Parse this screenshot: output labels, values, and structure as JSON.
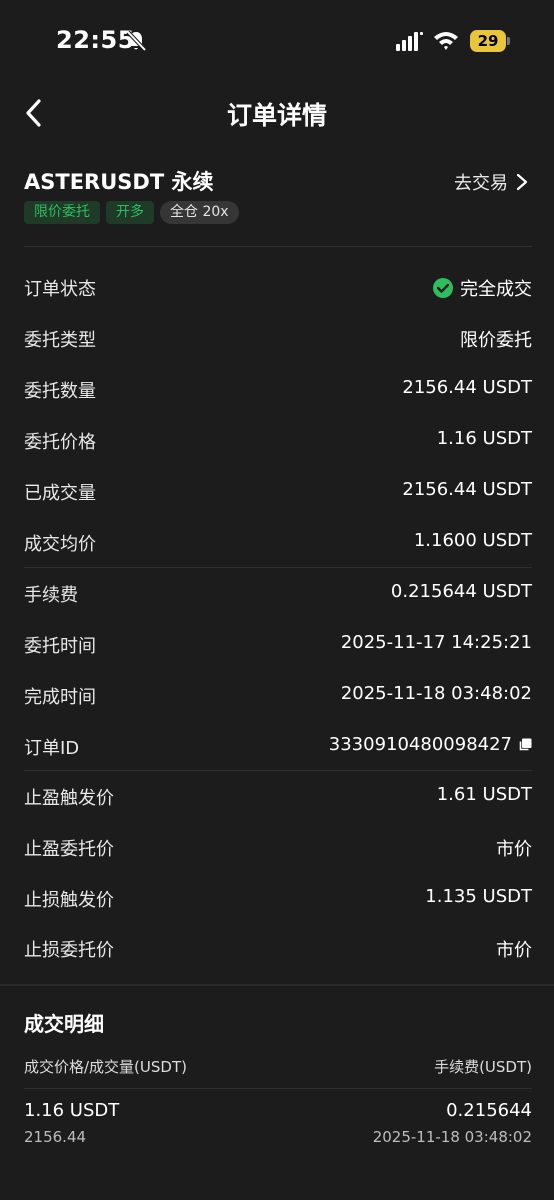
{
  "status_bar": {
    "time": "22:55",
    "battery": "29"
  },
  "header": {
    "title": "订单详情"
  },
  "order": {
    "symbol": "ASTERUSDT 永续",
    "trade_link": "去交易",
    "tags": [
      "限价委托",
      "开多",
      "全仓 20x"
    ]
  },
  "fields": [
    {
      "label": "订单状态",
      "value": "完全成交"
    },
    {
      "label": "委托类型",
      "value": "限价委托"
    },
    {
      "label": "委托数量",
      "value": "2156.44 USDT"
    },
    {
      "label": "委托价格",
      "value": "1.16 USDT"
    },
    {
      "label": "已成交量",
      "value": "2156.44 USDT"
    },
    {
      "label": "成交均价",
      "value": "1.1600 USDT"
    },
    {
      "label": "手续费",
      "value": "0.215644 USDT"
    },
    {
      "label": "委托时间",
      "value": "2025-11-17 14:25:21"
    },
    {
      "label": "完成时间",
      "value": "2025-11-18 03:48:02"
    },
    {
      "label": "订单ID",
      "value": "3330910480098427"
    },
    {
      "label": "止盈触发价",
      "value": "1.61 USDT"
    },
    {
      "label": "止盈委托价",
      "value": "市价"
    },
    {
      "label": "止损触发价",
      "value": "1.135 USDT"
    },
    {
      "label": "止损委托价",
      "value": "市价"
    }
  ],
  "fills": {
    "title": "成交明细",
    "col_left": "成交价格/成交量(USDT)",
    "col_right": "手续费(USDT)",
    "rows": [
      {
        "price": "1.16 USDT",
        "qty": "2156.44",
        "fee": "0.215644",
        "time": "2025-11-18 03:48:02"
      }
    ]
  },
  "colors": {
    "background": "#1c1c1c",
    "accent_green": "#2ebd5f",
    "battery": "#e8c53a"
  }
}
